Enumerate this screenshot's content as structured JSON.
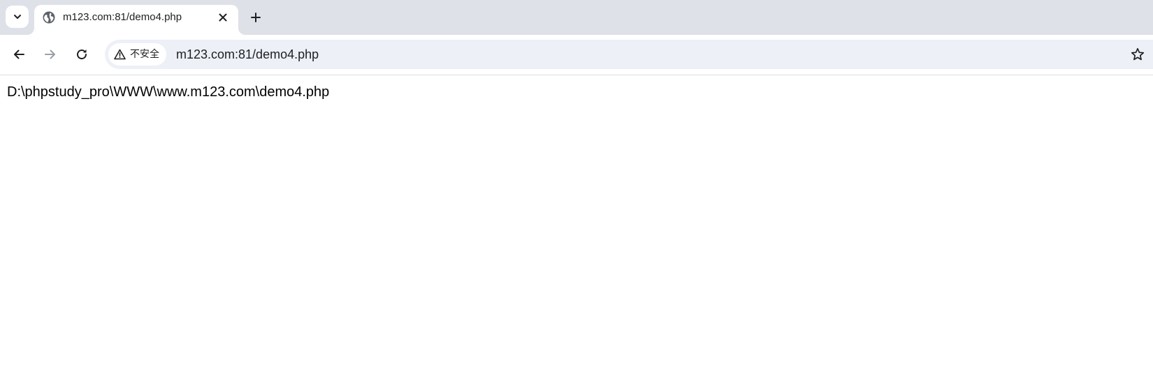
{
  "tab": {
    "title": "m123.com:81/demo4.php",
    "favicon": "globe-icon"
  },
  "toolbar": {
    "back_icon": "arrow-left-icon",
    "forward_icon": "arrow-right-icon",
    "reload_icon": "reload-icon",
    "security_label": "不安全",
    "security_icon": "warning-icon",
    "url": "m123.com:81/demo4.php",
    "bookmark_icon": "star-icon"
  },
  "page": {
    "body_text": "D:\\phpstudy_pro\\WWW\\www.m123.com\\demo4.php"
  },
  "colors": {
    "tabstrip_bg": "#dee1e7",
    "omnibox_bg": "#edf0f7",
    "text": "#1f1f1f",
    "disabled_icon": "#9aa0a6"
  }
}
